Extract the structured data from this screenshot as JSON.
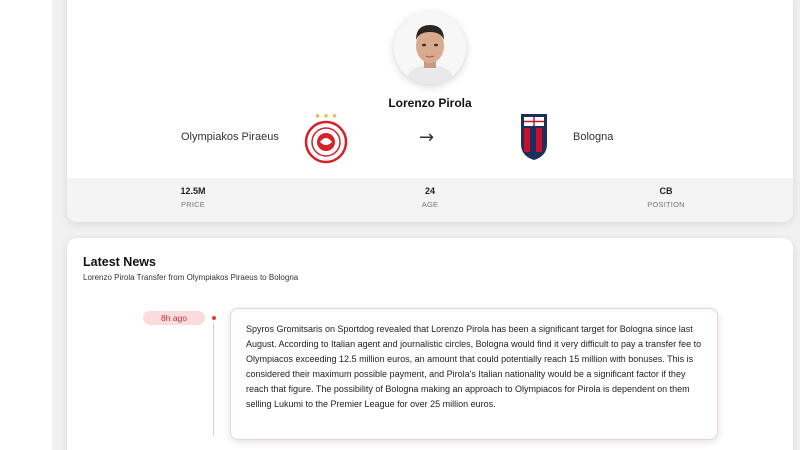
{
  "transfer": {
    "player_name": "Lorenzo Pirola",
    "from_club": "Olympiakos Piraeus",
    "to_club": "Bologna",
    "arrow": "→",
    "stats": [
      {
        "value": "12.5M",
        "label": "PRICE"
      },
      {
        "value": "24",
        "label": "AGE"
      },
      {
        "value": "CB",
        "label": "POSITION"
      }
    ]
  },
  "news": {
    "title": "Latest News",
    "subtitle": "Lorenzo Pirola Transfer from Olympiakos Piraeus to Bologna",
    "entries": [
      {
        "time": "8h ago",
        "text": "Spyros Gromitsaris on Sportdog revealed that Lorenzo Pirola has been a significant target for Bologna since last August. According to Italian agent and journalistic circles, Bologna would find it very difficult to pay a transfer fee to Olympiacos exceeding 12.5 million euros, an amount that could potentially reach 15 million with bonuses. This is considered their maximum possible payment, and Pirola's Italian nationality would be a significant factor if they reach that figure. The possibility of Bologna making an approach to Olympiacos for Pirola is dependent on them selling Lukumi to the Premier League for over 25 million euros."
      }
    ]
  },
  "colors": {
    "olympiakos_red": "#d6202a",
    "bologna_red": "#c8102e",
    "bologna_blue": "#1a2f5a",
    "badge_bg": "#fbdcdc",
    "badge_text": "#b33333"
  }
}
